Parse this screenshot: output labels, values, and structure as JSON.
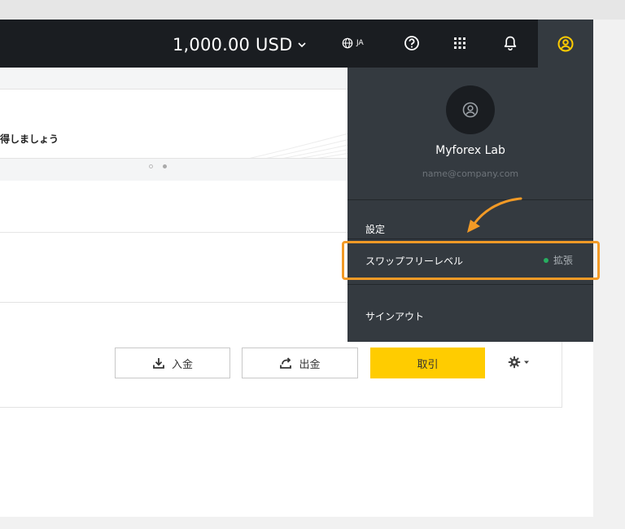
{
  "header": {
    "balance": "1,000.00 USD",
    "language": "JA"
  },
  "banner": {
    "text": "得しましょう"
  },
  "account": {
    "deposit_label": "入金",
    "withdraw_label": "出金",
    "trade_label": "取引"
  },
  "user_menu": {
    "name": "Myforex Lab",
    "email": "name@company.com",
    "items": {
      "settings": "設定",
      "swap_free_level": "スワップフリーレベル",
      "swap_status": "拡張",
      "sign_out": "サインアウト"
    }
  },
  "colors": {
    "topbar": "#1a1d21",
    "menu_bg": "#343a40",
    "accent": "#ffcc00",
    "highlight": "#f29a26",
    "status_green": "#27ae60"
  }
}
